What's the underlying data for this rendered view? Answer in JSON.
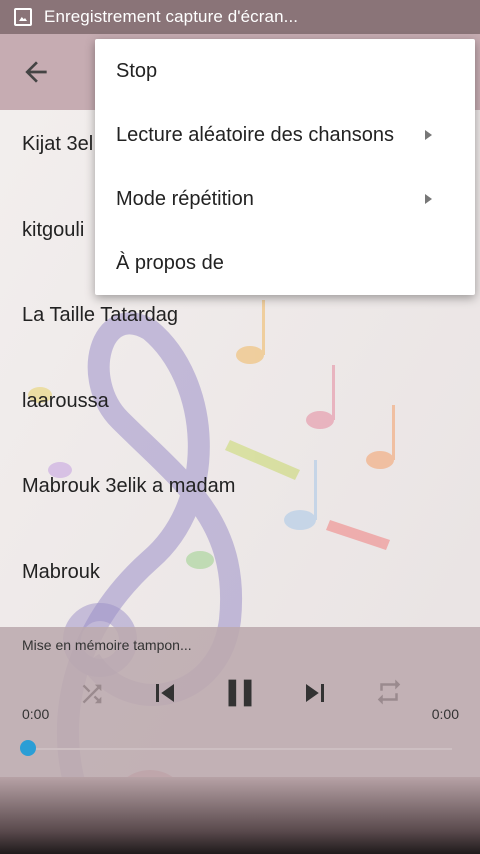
{
  "status_bar": {
    "notification_text": "Enregistrement capture d'écran...",
    "icon": "image-icon"
  },
  "toolbar": {
    "back_icon": "arrow-back-icon"
  },
  "songs": [
    "Kijat 3el",
    "kitgouli",
    "La Taille Tatardag",
    "laaroussa",
    "Mabrouk 3elik a madam",
    "Mabrouk"
  ],
  "menu": {
    "items": [
      {
        "label": "Stop",
        "has_submenu": false
      },
      {
        "label": "Lecture aléatoire des chansons",
        "has_submenu": true
      },
      {
        "label": "Mode répétition",
        "has_submenu": true
      },
      {
        "label": "À propos de",
        "has_submenu": false
      }
    ]
  },
  "player": {
    "status": "Mise en mémoire tampon...",
    "time_elapsed": "0:00",
    "time_total": "0:00",
    "progress": 0,
    "icons": [
      "shuffle-icon",
      "skip-previous-icon",
      "pause-icon",
      "skip-next-icon",
      "repeat-icon"
    ]
  },
  "colors": {
    "status_bar": "#8a7478",
    "toolbar": "#c6acb2",
    "player_bg": "#bcaaae",
    "seek_knob": "#2a9ed6"
  }
}
